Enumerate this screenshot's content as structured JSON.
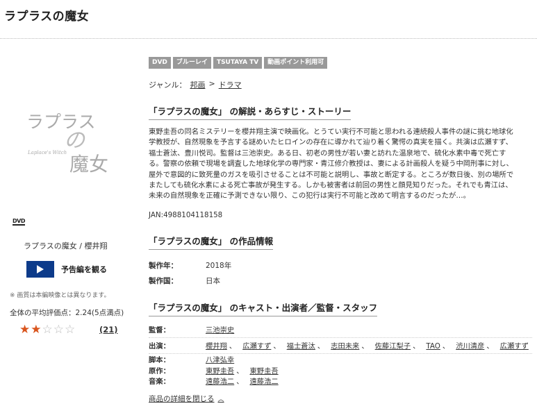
{
  "page": {
    "title": "ラプラスの魔女"
  },
  "jacket": {
    "title_line1": "ラプラス",
    "title_no": "の",
    "title_line2": "魔女",
    "subtitle": "Laplace's Witch"
  },
  "left": {
    "format_logo": "DVD",
    "caption": "ラプラスの魔女 / 櫻井翔",
    "trailer_label": "予告編を観る",
    "note": "※ 画質は本編映像とは異なります。",
    "rating_text": "全体の平均評価点：2.24(5点満点)",
    "rating_value": 2.24,
    "rating_max": 5,
    "review_count": "(21)",
    "star_color": "#d9541c"
  },
  "badges": [
    "DVD",
    "ブルーレイ",
    "TSUTAYA TV",
    "動画ポイント利用可"
  ],
  "genre": {
    "label": "ジャンル：",
    "items": [
      "邦画",
      "ドラマ"
    ],
    "sep": ">"
  },
  "synopsis": {
    "heading": "「ラプラスの魔女」 の解説・あらすじ・ストーリー",
    "lines": [
      "東野圭吾の同名ミステリーを櫻井翔主演で映画化。とうてい実行不可能と思われる連続殺人事件の謎に挑む地球化",
      "学教授が、自然現象を予言する謎めいたヒロインの存在に導かれて辿り着く驚愕の真実を描く。共演は広瀬すず、",
      "福士蒼汰、豊川悦司。監督は三池崇史。ある日、初老の男性が若い妻と訪れた温泉地で、硫化水素中毒で死亡す",
      "る。警察の依頼で現場を調査した地球化学の専門家・青江修介教授は、妻による計画殺人を疑う中岡刑事に対し、",
      "屋外で意図的に致死量のガスを吸引させることは不可能と説明し、事故と断定する。ところが数日後、別の場所で",
      "またしても硫化水素による死亡事故が発生する。しかも被害者は前回の男性と顔見知りだった。それでも青江は、",
      "未来の自然現象を正確に予測できない限り、この犯行は実行不可能と改めて明言するのだったが…。"
    ],
    "jan": "JAN:4988104118158"
  },
  "info": {
    "heading": "「ラプラスの魔女」 の作品情報",
    "rows": [
      {
        "label": "製作年：",
        "value": "2018年"
      },
      {
        "label": "製作国：",
        "value": "日本"
      }
    ]
  },
  "cast": {
    "heading": "「ラプラスの魔女」 のキャスト・出演者／監督・スタッフ",
    "director_label": "監督：",
    "director": [
      "三池崇史"
    ],
    "actors_label": "出演：",
    "actors": [
      "櫻井翔",
      "広瀬すず",
      "福士蒼汰",
      "志田未来",
      "佐藤江梨子",
      "TAO",
      "渋川清彦",
      "広瀬すず"
    ],
    "screenplay_label": "脚本：",
    "screenplay": [
      "八津弘幸"
    ],
    "original_label": "原作：",
    "original": [
      "東野圭吾",
      "東野圭吾"
    ],
    "music_label": "音楽：",
    "music": [
      "遠藤浩二",
      "遠藤浩二"
    ],
    "separator": "、"
  },
  "detail_toggle": "商品の詳細を閉じる",
  "colors": {
    "trailer_button": "#0d3b8a",
    "badge": "#999999"
  }
}
